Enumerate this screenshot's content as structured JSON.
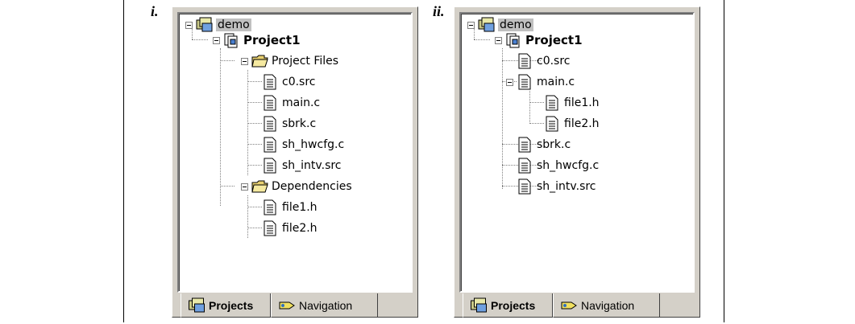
{
  "left": {
    "marker": "i.",
    "root": "demo",
    "project": "Project1",
    "folders": [
      {
        "name": "Project Files",
        "files": [
          "c0.src",
          "main.c",
          "sbrk.c",
          "sh_hwcfg.c",
          "sh_intv.src"
        ]
      },
      {
        "name": "Dependencies",
        "files": [
          "file1.h",
          "file2.h"
        ]
      }
    ],
    "tabs": [
      "Projects",
      "Navigation"
    ]
  },
  "right": {
    "marker": "ii.",
    "root": "demo",
    "project": "Project1",
    "items": [
      {
        "name": "c0.src"
      },
      {
        "name": "main.c",
        "children": [
          "file1.h",
          "file2.h"
        ]
      },
      {
        "name": "sbrk.c"
      },
      {
        "name": "sh_hwcfg.c"
      },
      {
        "name": "sh_intv.src"
      }
    ],
    "tabs": [
      "Projects",
      "Navigation"
    ]
  },
  "icons": {
    "workspace": "workspace-icon",
    "project": "project-icon",
    "folder": "folder-icon",
    "file": "file-icon",
    "navigation": "navigation-icon"
  }
}
